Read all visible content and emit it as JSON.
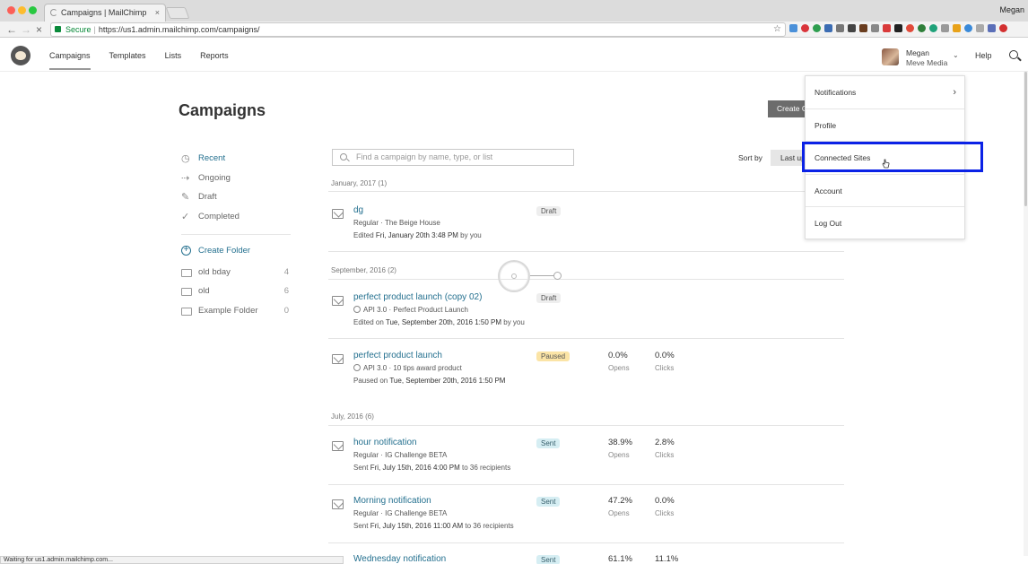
{
  "browser": {
    "tab_title": "Campaigns | MailChimp",
    "tab_close": "×",
    "os_user": "Megan",
    "secure_label": "Secure",
    "url": "https://us1.admin.mailchimp.com/campaigns/",
    "status": "Waiting for us1.admin.mailchimp.com..."
  },
  "header": {
    "nav": [
      "Campaigns",
      "Templates",
      "Lists",
      "Reports"
    ],
    "account_name": "Megan",
    "account_org": "Meve Media",
    "help": "Help"
  },
  "page": {
    "title": "Campaigns",
    "create_button": "Create Campaign",
    "search_placeholder": "Find a campaign by name, type, or list",
    "sort_label": "Sort by",
    "sort_value": "Last updated"
  },
  "sidebar": {
    "filters": [
      "Recent",
      "Ongoing",
      "Draft",
      "Completed"
    ],
    "create_folder": "Create Folder",
    "folders": [
      {
        "name": "old bday",
        "count": "4"
      },
      {
        "name": "old",
        "count": "6"
      },
      {
        "name": "Example Folder",
        "count": "0"
      }
    ]
  },
  "groups": [
    "January, 2017 (1)",
    "September, 2016 (2)",
    "July, 2016 (6)"
  ],
  "campaigns": [
    {
      "name": "dg",
      "meta": "Regular · The Beige House",
      "when_prefix": "Edited ",
      "when_date": "Fri, January 20th 3:48 PM",
      "when_suffix": " by you",
      "status": "Draft"
    },
    {
      "name": "perfect product launch (copy 02)",
      "meta": "API 3.0 · Perfect Product Launch",
      "when_prefix": "Edited on ",
      "when_date": "Tue, September 20th, 2016 1:50 PM",
      "when_suffix": " by you",
      "status": "Draft"
    },
    {
      "name": "perfect product launch",
      "meta": "API 3.0 · 10 tips award product",
      "when_prefix": "Paused on ",
      "when_date": "Tue, September 20th, 2016 1:50 PM",
      "when_suffix": "",
      "status": "Paused",
      "opens": "0.0%",
      "clicks": "0.0%"
    },
    {
      "name": "hour notification",
      "meta": "Regular · IG Challenge BETA",
      "when_prefix": "Sent ",
      "when_date": "Fri, July 15th, 2016 4:00 PM",
      "when_suffix": " to 36 recipients",
      "status": "Sent",
      "opens": "38.9%",
      "clicks": "2.8%"
    },
    {
      "name": "Morning notification",
      "meta": "Regular · IG Challenge BETA",
      "when_prefix": "Sent ",
      "when_date": "Fri, July 15th, 2016 11:00 AM",
      "when_suffix": " to 36 recipients",
      "status": "Sent",
      "opens": "47.2%",
      "clicks": "0.0%"
    },
    {
      "name": "Wednesday notification",
      "status": "Sent",
      "opens": "61.1%",
      "clicks": "11.1%"
    }
  ],
  "stat_labels": {
    "opens": "Opens",
    "clicks": "Clicks"
  },
  "account_menu": {
    "items": [
      "Notifications",
      "Profile",
      "Connected Sites",
      "Account",
      "Log Out"
    ],
    "highlight_color": "#0b22e6"
  },
  "colors": {
    "link": "#24708f",
    "sent_badge": "#d6eef3",
    "paused_badge": "#fbe4a6",
    "draft_badge": "#eeeeee"
  }
}
